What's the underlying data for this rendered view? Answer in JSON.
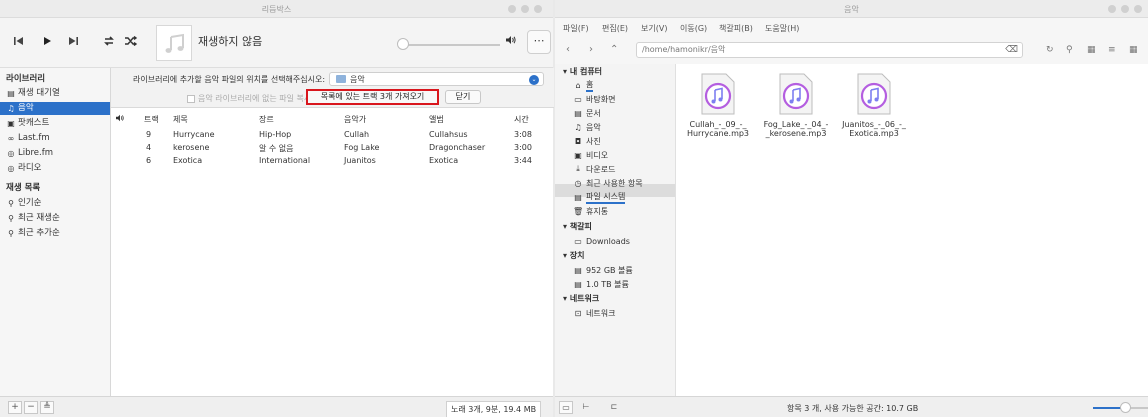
{
  "rhythmbox": {
    "title": "리듬박스",
    "now_playing": "재생하지 않음",
    "volume_icon": "speaker-icon",
    "menu_label": "⋯",
    "sidebar": {
      "library_heading": "라이브러리",
      "library_items": [
        "재생 대기열",
        "음악",
        "팟캐스트",
        "Last.fm",
        "Libre.fm",
        "라디오"
      ],
      "playlists_heading": "재생 목록",
      "playlist_items": [
        "인기순",
        "최근 재생순",
        "최근 추가순"
      ]
    },
    "import": {
      "prompt": "라이브러리에 추가할 음악 파일의 위치를 선택해주십시오:",
      "location": "음악",
      "copy_checkbox": "음악 라이브러리에 없는 파일 복사",
      "import_button": "목록에 있는 트랙 3개 가져오기",
      "close_button": "닫기"
    },
    "table": {
      "headers": [
        "트랙",
        "제목",
        "장르",
        "음악가",
        "앨범",
        "시간"
      ],
      "rows": [
        {
          "track": "9",
          "title": "Hurrycane",
          "genre": "Hip-Hop",
          "artist": "Cullah",
          "album": "Cullahsus",
          "time": "3:08"
        },
        {
          "track": "4",
          "title": "kerosene",
          "genre": "알 수 없음",
          "artist": "Fog Lake",
          "album": "Dragonchaser",
          "time": "3:00"
        },
        {
          "track": "6",
          "title": "Exotica",
          "genre": "International",
          "artist": "Juanitos",
          "album": "Exotica",
          "time": "3:44"
        }
      ]
    },
    "bottom_buttons": [
      "+",
      "−",
      "≜"
    ],
    "status": "노래 3개, 9분, 19.4 MB"
  },
  "files": {
    "title": "음악",
    "menus": [
      "파일(F)",
      "편집(E)",
      "보기(V)",
      "이동(G)",
      "책갈피(B)",
      "도움말(H)"
    ],
    "path": "/home/hamonikr/음악",
    "sidebar": {
      "computer_heading": "내 컴퓨터",
      "computer_items": [
        "홈",
        "바탕화면",
        "문서",
        "음악",
        "사진",
        "비디오",
        "다운로드",
        "최근 사용한 항목",
        "파일 시스템",
        "휴지통"
      ],
      "bookmarks_heading": "책갈피",
      "bookmark_items": [
        "Downloads"
      ],
      "devices_heading": "장치",
      "device_items": [
        "952 GB 볼륨",
        "1.0 TB 볼륨"
      ],
      "network_heading": "네트워크",
      "network_items": [
        "네트워크"
      ]
    },
    "files": [
      {
        "line1": "Cullah_-_09_-_",
        "line2": "Hurrycane.mp3"
      },
      {
        "line1": "Fog_Lake_-_04_-",
        "line2": "_kerosene.mp3"
      },
      {
        "line1": "Juanitos_-_06_-_",
        "line2": "Exotica.mp3"
      }
    ],
    "status": "항목 3 개, 사용 가능한 공간: 10.7 GB"
  }
}
